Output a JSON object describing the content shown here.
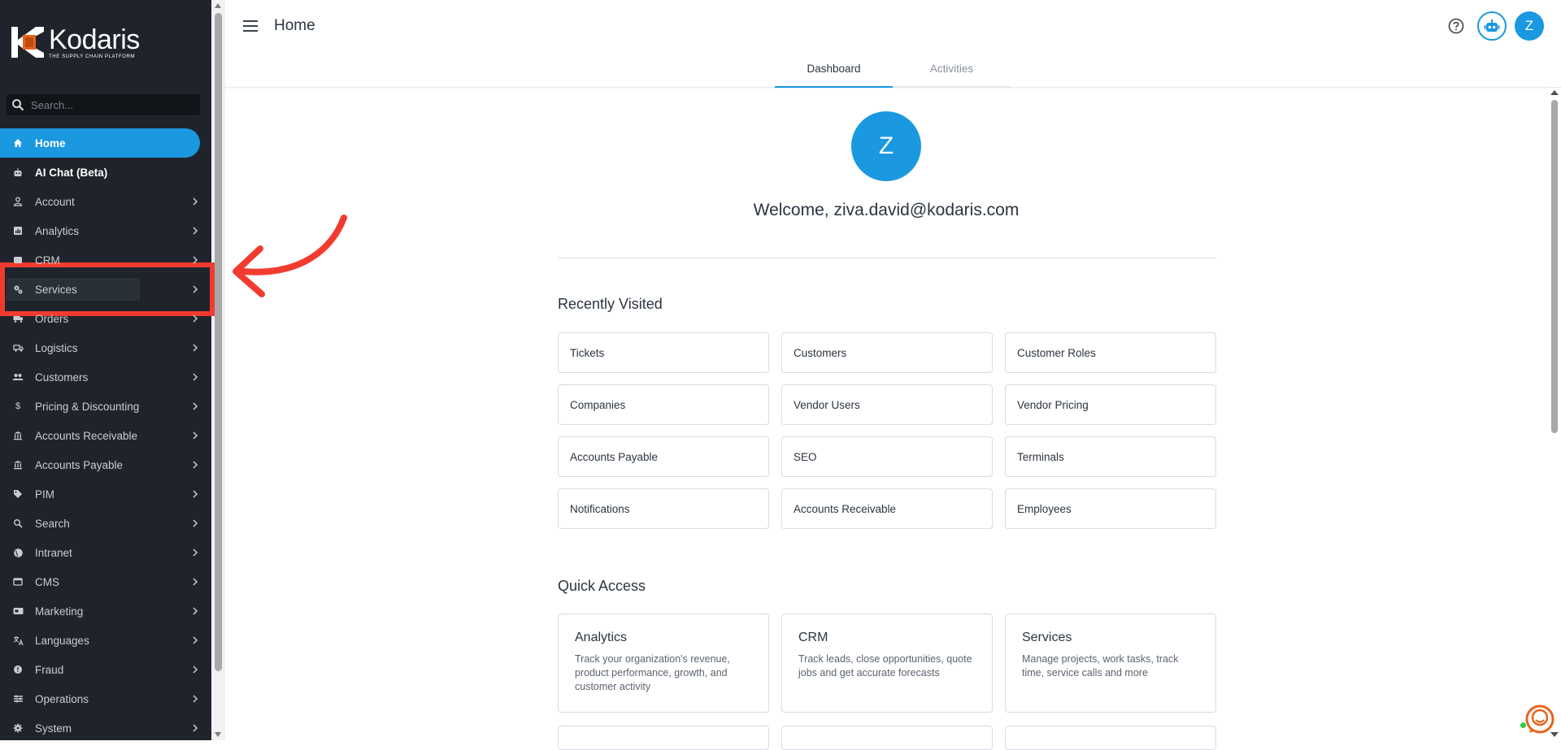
{
  "brand": {
    "name": "Kodaris",
    "tagline": "THE SUPPLY CHAIN PLATFORM"
  },
  "search": {
    "placeholder": "Search..."
  },
  "sidebar": {
    "items": [
      {
        "label": "Home",
        "icon": "home-icon",
        "active": true,
        "chevron": false
      },
      {
        "label": "AI Chat (Beta)",
        "icon": "robot-icon",
        "chevron": false
      },
      {
        "label": "Account",
        "icon": "person-icon",
        "chevron": true
      },
      {
        "label": "Analytics",
        "icon": "chart-icon",
        "chevron": true
      },
      {
        "label": "CRM",
        "icon": "crm-icon",
        "chevron": true
      },
      {
        "label": "Services",
        "icon": "gears-icon",
        "chevron": true
      },
      {
        "label": "Orders",
        "icon": "truck-icon",
        "chevron": true
      },
      {
        "label": "Logistics",
        "icon": "van-icon",
        "chevron": true
      },
      {
        "label": "Customers",
        "icon": "people-icon",
        "chevron": true
      },
      {
        "label": "Pricing & Discounting",
        "icon": "dollar-icon",
        "chevron": true
      },
      {
        "label": "Accounts Receivable",
        "icon": "bank-icon",
        "chevron": true
      },
      {
        "label": "Accounts Payable",
        "icon": "bank-icon",
        "chevron": true
      },
      {
        "label": "PIM",
        "icon": "tag-icon",
        "chevron": true
      },
      {
        "label": "Search",
        "icon": "search-icon",
        "chevron": true
      },
      {
        "label": "Intranet",
        "icon": "globe-icon",
        "chevron": true
      },
      {
        "label": "CMS",
        "icon": "browser-icon",
        "chevron": true
      },
      {
        "label": "Marketing",
        "icon": "card-icon",
        "chevron": true
      },
      {
        "label": "Languages",
        "icon": "translate-icon",
        "chevron": true
      },
      {
        "label": "Fraud",
        "icon": "shield-icon",
        "chevron": true
      },
      {
        "label": "Operations",
        "icon": "settings-icon",
        "chevron": true
      },
      {
        "label": "System",
        "icon": "gear-icon",
        "chevron": true
      }
    ]
  },
  "header": {
    "title": "Home",
    "avatar_letter": "Z"
  },
  "tabs": [
    {
      "label": "Dashboard",
      "active": true
    },
    {
      "label": "Activities",
      "active": false
    }
  ],
  "profile": {
    "avatar_letter": "Z",
    "welcome": "Welcome, ziva.david@kodaris.com"
  },
  "recently_visited": {
    "title": "Recently Visited",
    "items": [
      "Tickets",
      "Customers",
      "Customer Roles",
      "Companies",
      "Vendor Users",
      "Vendor Pricing",
      "Accounts Payable",
      "SEO",
      "Terminals",
      "Notifications",
      "Accounts Receivable",
      "Employees"
    ]
  },
  "quick_access": {
    "title": "Quick Access",
    "items": [
      {
        "title": "Analytics",
        "desc": "Track your organization's revenue, product performance, growth, and customer activity"
      },
      {
        "title": "CRM",
        "desc": "Track leads, close opportunities, quote jobs and get accurate forecasts"
      },
      {
        "title": "Services",
        "desc": "Manage projects, work tasks, track time, service calls and more"
      }
    ]
  },
  "colors": {
    "accent": "#1a98e0",
    "sidebar_bg": "#1f242c",
    "highlight": "#f23b2f"
  }
}
